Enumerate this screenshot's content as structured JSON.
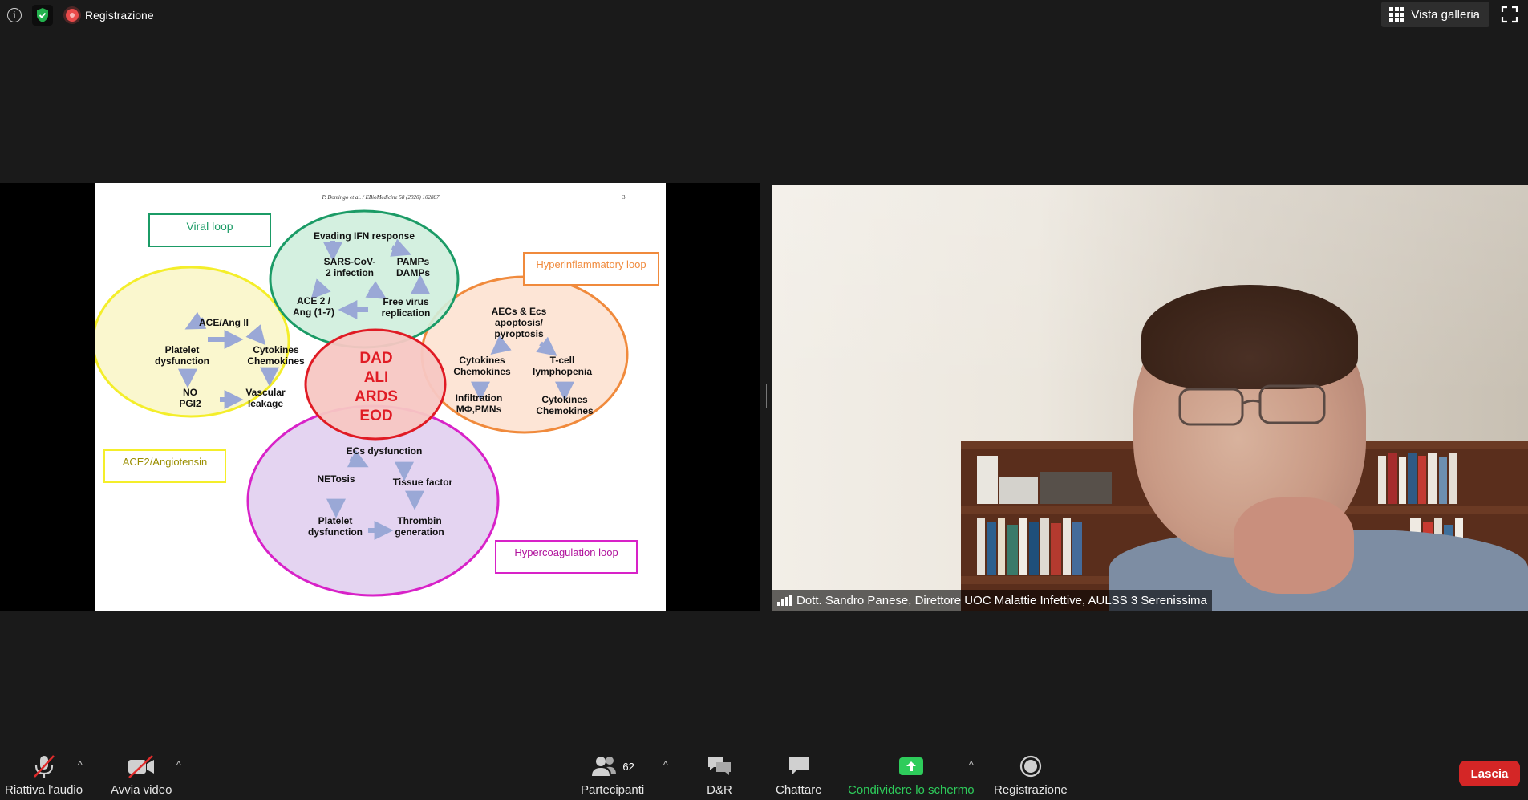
{
  "top_bar": {
    "recording_label": "Registrazione",
    "gallery_label": "Vista galleria"
  },
  "slide": {
    "header": "P. Domingo et al. / EBioMedicine 58 (2020) 102887",
    "page": "3",
    "boxes": {
      "viral": "Viral loop",
      "hyperinflammatory": "Hyperinflammatory loop",
      "ace2": "ACE2/Angiotensin",
      "hypercoagulation": "Hypercoagulation loop"
    },
    "viral_circle": {
      "t1": "Evading IFN response",
      "t2": "SARS-CoV-",
      "t3": "2 infection",
      "t4": "PAMPs",
      "t5": "DAMPs",
      "t6": "ACE 2 /",
      "t7": "Ang (1-7)",
      "t8": "Free virus",
      "t9": "replication"
    },
    "ace_circle": {
      "t1": "ACE/Ang II",
      "t2": "Platelet",
      "t3": "dysfunction",
      "t4": "Cytokines",
      "t5": "Chemokines",
      "t6": "NO",
      "t7": "PGI2",
      "t8": "Vascular",
      "t9": "leakage"
    },
    "center": {
      "t1": "DAD",
      "t2": "ALI",
      "t3": "ARDS",
      "t4": "EOD"
    },
    "hyper_circle": {
      "t1": "AECs & Ecs",
      "t2": "apoptosis/",
      "t3": "pyroptosis",
      "t4": "Cytokines",
      "t5": "Chemokines",
      "t6": "T-cell",
      "t7": "lymphopenia",
      "t8": "Infiltration",
      "t9": "MΦ,PMNs",
      "t10": "Cytokines",
      "t11": "Chemokines"
    },
    "coag_circle": {
      "t1": "ECs dysfunction",
      "t2": "NETosis",
      "t3": "Tissue factor",
      "t4": "Platelet",
      "t5": "dysfunction",
      "t6": "Thrombin",
      "t7": "generation"
    }
  },
  "video": {
    "participant_name": "Dott. Sandro Panese, Direttore UOC Malattie Infettive, AULSS 3 Serenissima"
  },
  "bottom_bar": {
    "audio_label": "Riattiva l'audio",
    "video_label": "Avvia video",
    "participants_label": "Partecipanti",
    "participants_count": "62",
    "qa_label": "D&R",
    "chat_label": "Chattare",
    "share_label": "Condividere lo schermo",
    "record_label": "Registrazione",
    "leave_label": "Lascia"
  },
  "colors": {
    "background": "#1a1a1a",
    "viral": "#1b9b66",
    "ace": "#f4ee2a",
    "hyper": "#f08a3c",
    "coag": "#d822c8",
    "center_red": "#e01b24",
    "share_green": "#2ecc5b",
    "leave_red": "#d42626"
  }
}
